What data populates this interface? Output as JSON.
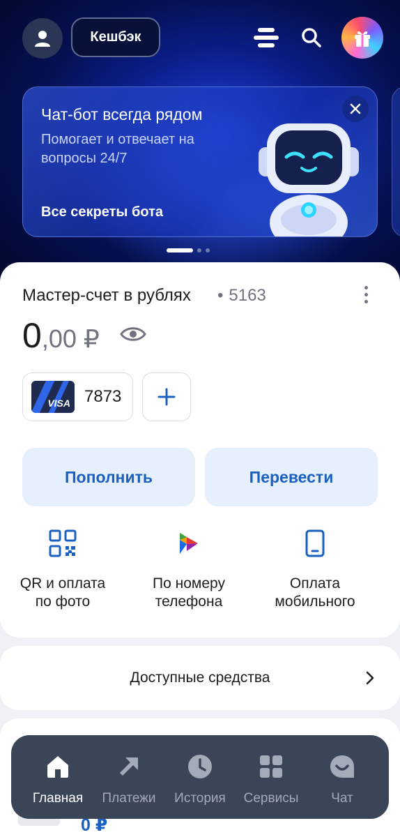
{
  "header": {
    "cashback_label": "Кешбэк",
    "icons": [
      "profile-icon",
      "menu-icon",
      "search-icon",
      "gift-icon"
    ]
  },
  "banner": {
    "title": "Чат-бот всегда рядом",
    "subtitle": "Помогает и отвечает на вопросы 24/7",
    "link": "Все секреты бота",
    "pager": {
      "pages": 3,
      "active": 1
    }
  },
  "account": {
    "title": "Мастер-счет в рублях",
    "number": "5163",
    "balance_int": "0",
    "balance_frac": ",00 ₽",
    "card": {
      "brand": "VISA",
      "last4": "7873"
    },
    "actions": {
      "top_up": "Пополнить",
      "transfer": "Перевести"
    },
    "quick": [
      {
        "label_1": "QR и оплата",
        "label_2": "по фото",
        "icon": "qr-icon"
      },
      {
        "label_1": "По номеру",
        "label_2": "телефона",
        "icon": "sbp-icon"
      },
      {
        "label_1": "Оплата",
        "label_2": "мобильного",
        "icon": "phone-icon"
      }
    ]
  },
  "funds": {
    "label": "Доступные средства"
  },
  "peek": {
    "amount": "0 ₽"
  },
  "tabs": [
    {
      "label": "Главная",
      "icon": "home-icon",
      "active": true
    },
    {
      "label": "Платежи",
      "icon": "payments-arrow-icon"
    },
    {
      "label": "История",
      "icon": "clock-icon"
    },
    {
      "label": "Сервисы",
      "icon": "grid-icon"
    },
    {
      "label": "Чат",
      "icon": "chat-icon"
    }
  ],
  "colors": {
    "accent": "#1a5fc2",
    "action_bg": "#e6f0fc",
    "tabbar": "#3b4558",
    "hero": "#0b1e8a"
  }
}
